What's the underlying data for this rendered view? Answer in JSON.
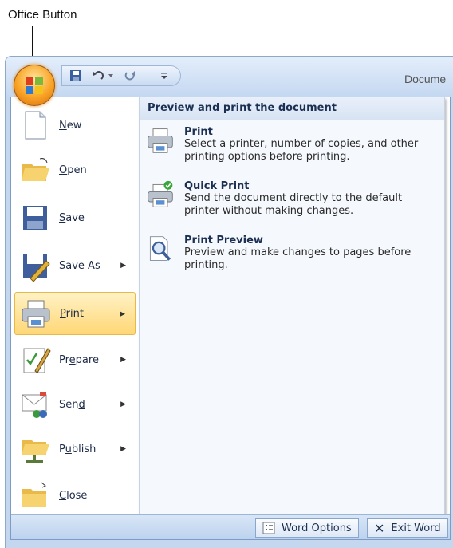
{
  "callout": {
    "label": "Office Button"
  },
  "titlebar": {
    "document_title": "Docume"
  },
  "menu": {
    "items": [
      {
        "label": "New",
        "key": "N",
        "has_submenu": false
      },
      {
        "label": "Open",
        "key": "O",
        "has_submenu": false
      },
      {
        "label": "Save",
        "key": "S",
        "has_submenu": false
      },
      {
        "label": "Save As",
        "key": "A",
        "has_submenu": true
      },
      {
        "label": "Print",
        "key": "P",
        "has_submenu": true,
        "active": true
      },
      {
        "label": "Prepare",
        "key": "e",
        "has_submenu": true
      },
      {
        "label": "Send",
        "key": "d",
        "has_submenu": true
      },
      {
        "label": "Publish",
        "key": "u",
        "has_submenu": true
      },
      {
        "label": "Close",
        "key": "C",
        "has_submenu": false
      }
    ],
    "panel": {
      "header": "Preview and print the document",
      "options": [
        {
          "title": "Print",
          "description": "Select a printer, number of copies, and other printing options before printing."
        },
        {
          "title": "Quick Print",
          "description": "Send the document directly to the default printer without making changes."
        },
        {
          "title": "Print Preview",
          "description": "Preview and make changes to pages before printing."
        }
      ]
    },
    "footer": {
      "word_options": "Word Options",
      "exit_word": "Exit Word"
    }
  },
  "colors": {
    "accent_orange": "#f9a326",
    "menu_border": "#7c9cc5",
    "hover_gold": "#ffd776"
  }
}
